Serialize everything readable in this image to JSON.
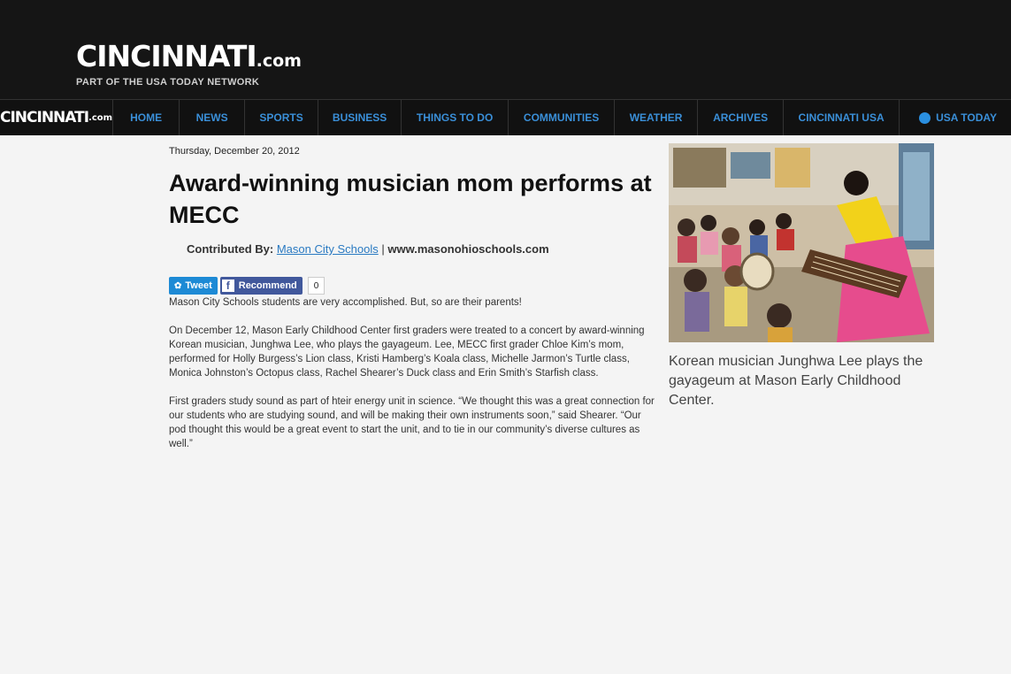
{
  "header": {
    "brand": "CINCINNATI",
    "brand_suffix": ".com",
    "tagline": "PART OF THE USA TODAY NETWORK"
  },
  "nav": {
    "logo": "CINCINNATI",
    "logo_suffix": ".com",
    "items": [
      "HOME",
      "NEWS",
      "SPORTS",
      "BUSINESS",
      "THINGS TO DO",
      "COMMUNITIES",
      "WEATHER",
      "ARCHIVES",
      "CINCINNATI USA",
      "USA TODAY"
    ]
  },
  "article": {
    "date": "Thursday, December 20, 2012",
    "title": "Award-winning musician mom performs at MECC",
    "contrib_label": "Contributed By:",
    "contrib_link": "Mason City Schools",
    "contrib_separator": "|",
    "contrib_site": "www.masonohioschools.com",
    "tweet_label": "Tweet",
    "recommend_label": "Recommend",
    "recommend_count": "0",
    "paragraphs": [
      "Mason City Schools students are very accomplished. But, so are their parents!",
      "On December 12, Mason Early Childhood Center first graders were treated to a concert by award-winning Korean musician, Junghwa Lee, who plays the gayageum. Lee, MECC first grader Chloe Kim’s mom, performed for Holly Burgess’s Lion class, Kristi Hamberg’s Koala class, Michelle Jarmon’s Turtle class, Monica Johnston’s Octopus class, Rachel Shearer’s Duck class and Erin Smith’s Starfish class.",
      "First graders study sound as part of hteir energy unit in science. “We thought this was a great connection for our students who are studying sound, and will be making their own instruments soon,” said Shearer. “Our pod thought this would be a great event to start the unit, and to tie in our community’s diverse cultures as well.”"
    ]
  },
  "photo": {
    "caption": "Korean musician Junghwa Lee plays the gayageum at Mason Early Childhood Center."
  },
  "colors": {
    "nav_link": "#3a8fd8",
    "header_bg": "#151515",
    "page_bg": "#f4f4f4"
  }
}
